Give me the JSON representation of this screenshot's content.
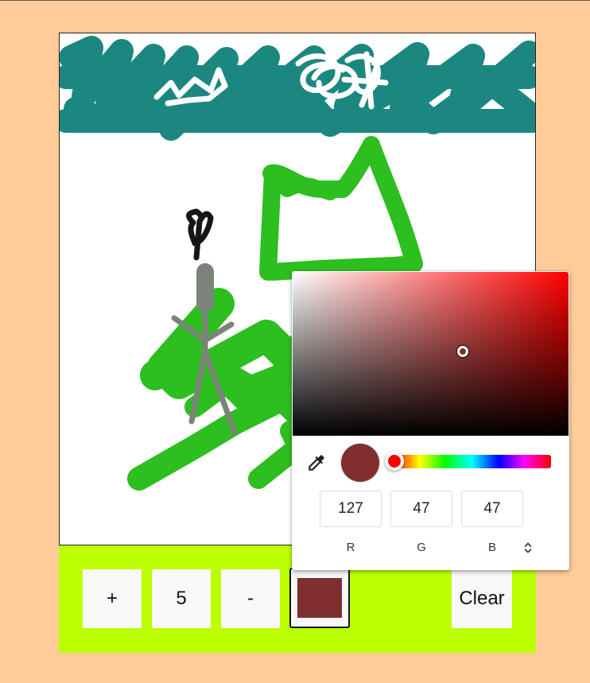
{
  "toolbar": {
    "plus_label": "+",
    "brush_size": "5",
    "minus_label": "-",
    "clear_label": "Clear"
  },
  "brush_color": "#7f2f2f",
  "toolbar_bg": "#bbff00",
  "page_bg": "#ffcc99",
  "color_picker": {
    "hue_color": "#ff0000",
    "current_color": "#7f2f2f",
    "rgb": {
      "r": "127",
      "g": "47",
      "b": "47"
    },
    "labels": {
      "r": "R",
      "g": "G",
      "b": "B"
    },
    "icons": [
      "eyedropper-icon",
      "swap-vertical-icon"
    ]
  }
}
